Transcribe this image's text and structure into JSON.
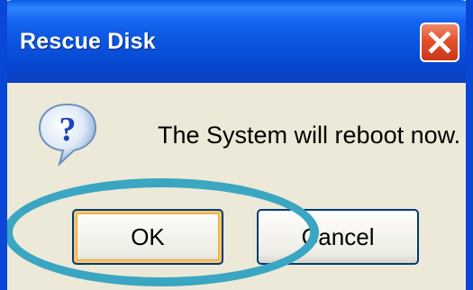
{
  "window": {
    "title": "Rescue Disk",
    "close_icon": "close-icon"
  },
  "dialog": {
    "icon": "question-icon",
    "message": "The System will reboot now."
  },
  "buttons": {
    "ok_label": "OK",
    "cancel_label": "Cancel"
  },
  "colors": {
    "titlebar": "#0a52dc",
    "close_button": "#e2512b",
    "dialog_background": "#ece9d8",
    "highlight_ring": "#3aa6c2"
  }
}
